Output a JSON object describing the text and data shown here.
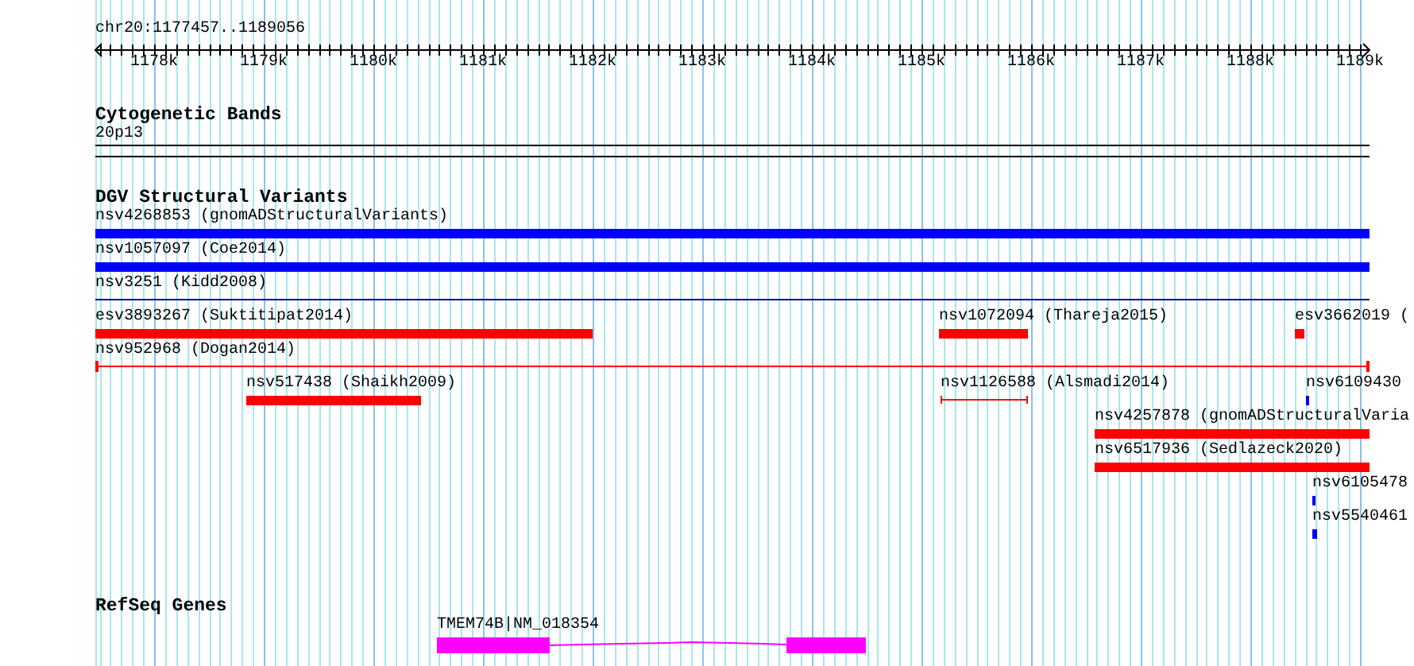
{
  "location": "chr20:1177457..1189056",
  "ruler": {
    "labels": [
      "1178k",
      "1179k",
      "1180k",
      "1181k",
      "1182k",
      "1183k",
      "1184k",
      "1185k",
      "1186k",
      "1187k",
      "1188k",
      "1189k"
    ]
  },
  "cytogenetic_bands": {
    "title": "Cytogenetic Bands",
    "bands": [
      {
        "label": "20p13"
      }
    ]
  },
  "dgv_track": {
    "title": "DGV Structural Variants",
    "rows": [
      {
        "features": [
          {
            "label": "nsv4268853 (gnomADStructuralVariants)",
            "kind": "bar",
            "color": "#0000ff"
          }
        ]
      },
      {
        "features": [
          {
            "label": "nsv1057097 (Coe2014)",
            "kind": "bar",
            "color": "#0000ff"
          }
        ]
      },
      {
        "features": [
          {
            "label": "nsv3251 (Kidd2008)",
            "kind": "line",
            "color": "#0000aa"
          }
        ]
      },
      {
        "features": [
          {
            "label": "esv3893267 (Suktitipat2014)",
            "kind": "bar",
            "color": "#ff0000"
          },
          {
            "label": "nsv1072094 (Thareja2015)",
            "kind": "bar",
            "color": "#ff0000"
          },
          {
            "label": "esv3662019 (",
            "kind": "bar",
            "color": "#ff0000"
          }
        ]
      },
      {
        "features": [
          {
            "label": "nsv952968 (Dogan2014)",
            "kind": "capped-line",
            "color": "#ff0000"
          }
        ]
      },
      {
        "features": [
          {
            "label": "nsv517438 (Shaikh2009)",
            "kind": "bar",
            "color": "#ff0000"
          },
          {
            "label": "nsv1126588 (Alsmadi2014)",
            "kind": "bracket",
            "color": "#ff0000"
          },
          {
            "label": "nsv6109430",
            "kind": "bar",
            "color": "#0000ff"
          }
        ]
      },
      {
        "features": [
          {
            "label": "nsv4257878 (gnomADStructuralVaria",
            "kind": "bar",
            "color": "#ff0000"
          }
        ]
      },
      {
        "features": [
          {
            "label": "nsv6517936 (Sedlazeck2020)",
            "kind": "bar",
            "color": "#ff0000"
          }
        ]
      },
      {
        "features": [
          {
            "label": "nsv6105478",
            "kind": "bar",
            "color": "#0000ff"
          }
        ]
      },
      {
        "features": [
          {
            "label": "nsv5540461",
            "kind": "bar",
            "color": "#0000ff"
          }
        ]
      }
    ]
  },
  "refseq_track": {
    "title": "RefSeq Genes",
    "genes": [
      {
        "label": "TMEM74B|NM_018354"
      }
    ]
  }
}
